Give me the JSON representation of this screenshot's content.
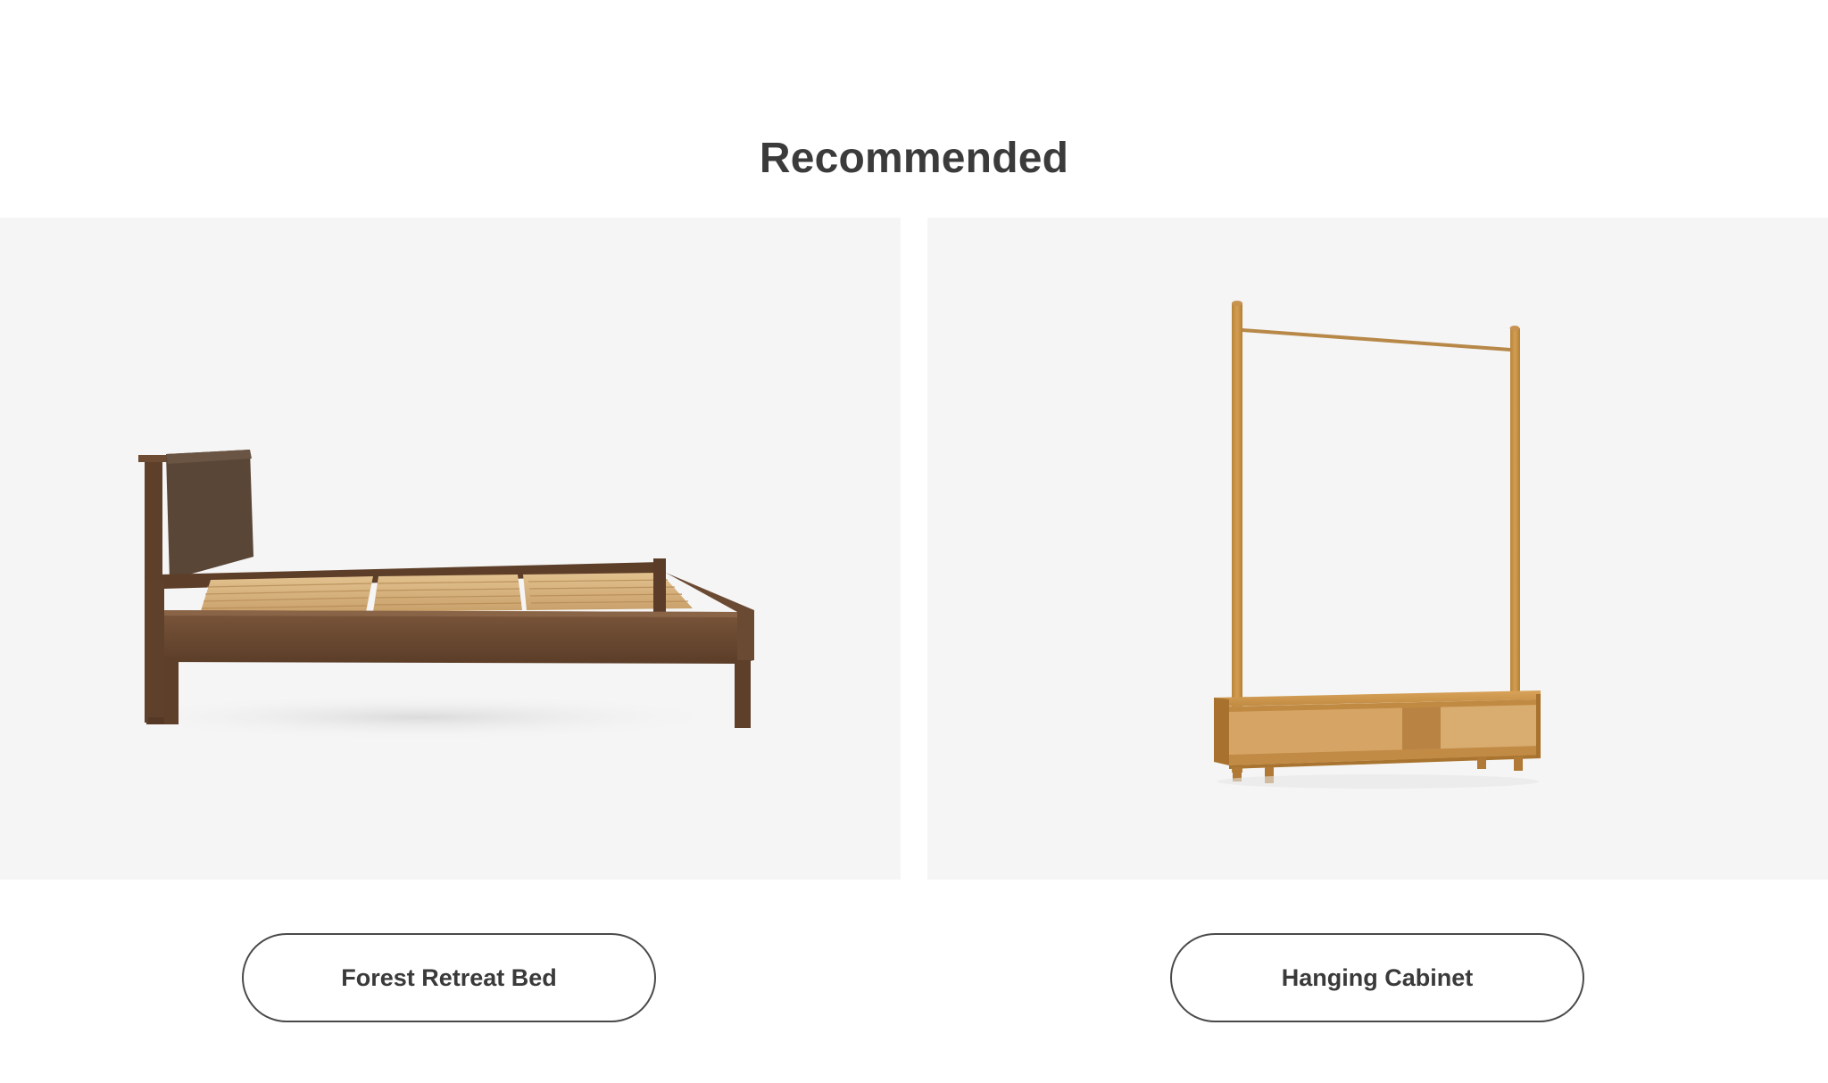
{
  "section": {
    "title": "Recommended"
  },
  "products": [
    {
      "name": "Forest Retreat Bed",
      "image_icon": "bed-product-image"
    },
    {
      "name": "Hanging Cabinet",
      "image_icon": "hanging-cabinet-product-image"
    }
  ],
  "colors": {
    "background": "#ffffff",
    "card_background": "#f5f5f5",
    "text": "#3a3a3a",
    "button_border": "#4a4a4a",
    "walnut": "#6b4a33",
    "oak": "#c9913f"
  }
}
